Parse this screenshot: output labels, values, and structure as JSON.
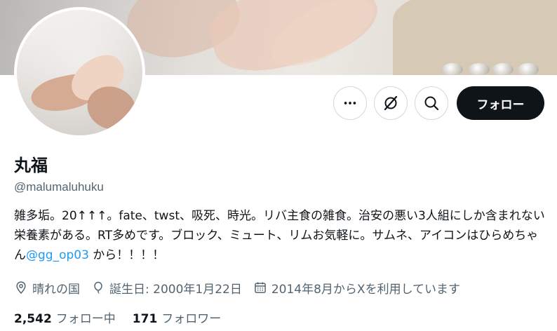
{
  "profile": {
    "name": "丸福",
    "handle": "@malumaluhuku",
    "bio_text": "雑多垢。20↑↑↑。fate、twst、吸死、時光。リバ主食の雑食。治安の悪い3人組にしか含まれない栄養素がある。RT多めです。ブロック、ミュート、リムお気軽に。サムネ、アイコンはひらめちゃん",
    "bio_link": "@gg_op03",
    "bio_suffix": " から！！！！",
    "location": "晴れの国",
    "birthday": "誕生日: 2000年1月22日",
    "joined": "2014年8月からXを利用しています"
  },
  "actions": {
    "follow_label": "フォロー"
  },
  "stats": {
    "following_count": "2,542",
    "following_label": "フォロー中",
    "followers_count": "171",
    "followers_label": "フォロワー"
  },
  "colors": {
    "text": "#0f1419",
    "secondary": "#536471",
    "link": "#1d9bf0",
    "button_bg": "#0f1419",
    "border": "#cfd9de"
  },
  "icons": [
    "more-icon",
    "grok-icon",
    "search-icon",
    "location-icon",
    "birthday-icon",
    "calendar-icon"
  ]
}
